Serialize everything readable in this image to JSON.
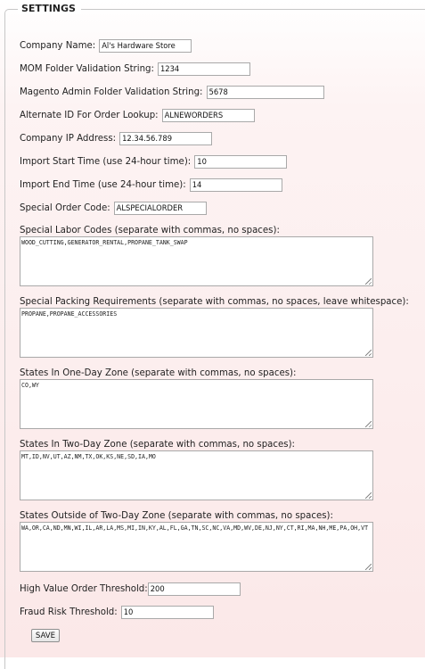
{
  "legend": "SETTINGS",
  "fields": [
    {
      "label": "Company Name:",
      "value": "Al's Hardware Store"
    },
    {
      "label": "MOM Folder Validation String:",
      "value": "1234"
    },
    {
      "label": "Magento Admin Folder Validation String:",
      "value": "5678"
    },
    {
      "label": "Alternate ID For Order Lookup:",
      "value": "ALNEWORDERS"
    },
    {
      "label": "Company IP Address:",
      "value": "12.34.56.789"
    },
    {
      "label": "Import Start Time (use 24-hour time):",
      "value": "10"
    },
    {
      "label": "Import End Time (use 24-hour time):",
      "value": "14"
    },
    {
      "label": "Special Order Code:",
      "value": "ALSPECIALORDER"
    }
  ],
  "textareas": [
    {
      "label": "Special Labor Codes (separate with commas, no spaces):",
      "value": "WOOD_CUTTING,GENERATOR_RENTAL,PROPANE_TANK_SWAP"
    },
    {
      "label": "Special Packing Requirements (separate with commas, no spaces, leave whitespace):",
      "value": "PROPANE,PROPANE_ACCESSORIES"
    },
    {
      "label": "States In One-Day Zone (separate with commas, no spaces):",
      "value": "CO,WY"
    },
    {
      "label": "States In Two-Day Zone (separate with commas, no spaces):",
      "value": "MT,ID,NV,UT,AZ,NM,TX,OK,KS,NE,SD,IA,MO"
    },
    {
      "label": "States Outside of Two-Day Zone (separate with commas, no spaces):",
      "value": "WA,OR,CA,ND,MN,WI,IL,AR,LA,MS,MI,IN,KY,AL,FL,GA,TN,SC,NC,VA,MD,WV,DE,NJ,NY,CT,RI,MA,NH,ME,PA,OH,VT"
    }
  ],
  "thresholds": [
    {
      "label": "High Value Order Threshold:",
      "value": "200"
    },
    {
      "label": "Fraud Risk Threshold:",
      "value": "10"
    }
  ],
  "save_label": "SAVE"
}
